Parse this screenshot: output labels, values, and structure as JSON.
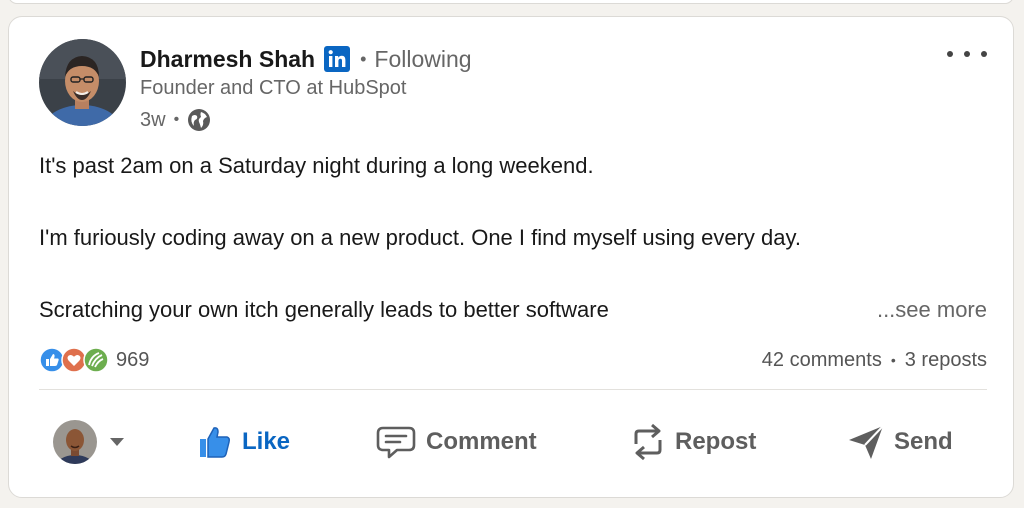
{
  "post": {
    "author_name": "Dharmesh Shah",
    "badge_icon": "linkedin-icon",
    "separator": "•",
    "follow_status": "Following",
    "headline": "Founder and CTO at HubSpot",
    "timestamp": "3w",
    "visibility_icon": "globe-icon",
    "menu_icon": "more-icon",
    "text": {
      "line1": "It's past 2am on a Saturday night during a long weekend.",
      "line2": "I'm furiously coding away on a new product. One I find myself using every day.",
      "line3": "Scratching your own itch generally leads to better software"
    },
    "see_more": "...see more"
  },
  "social": {
    "reaction_icons": [
      "like-reaction-icon",
      "love-reaction-icon",
      "support-reaction-icon"
    ],
    "reaction_count": "969",
    "comments": "42 comments",
    "separator": "•",
    "reposts": "3 reposts"
  },
  "actions": {
    "like": {
      "label": "Like",
      "icon": "thumbs-up-icon",
      "color": "#0a66c2"
    },
    "comment": {
      "label": "Comment",
      "icon": "comment-icon"
    },
    "repost": {
      "label": "Repost",
      "icon": "repost-icon"
    },
    "send": {
      "label": "Send",
      "icon": "send-icon"
    }
  },
  "colors": {
    "brand": "#0a66c2",
    "muted_text": "#666666",
    "background": "#f4f2ee",
    "card": "#ffffff"
  }
}
